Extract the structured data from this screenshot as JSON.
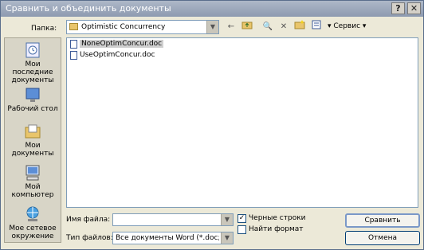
{
  "window": {
    "title": "Сравнить и объединить документы",
    "help_button": "?",
    "close_button": "✕"
  },
  "toolbar": {
    "look_in_label": "Папка:",
    "look_in_value": "Optimistic Concurrency",
    "back_icon": "←",
    "up_icon": "folder-up-icon",
    "search_icon": "🔍",
    "delete_icon": "✕",
    "new_folder_icon": "new-folder-icon",
    "views_icon": "views-icon",
    "tools_label": "Сервис"
  },
  "places": [
    {
      "label": "Мои последние документы",
      "icon": "recent-icon"
    },
    {
      "label": "Рабочий стол",
      "icon": "desktop-icon"
    },
    {
      "label": "Мои документы",
      "icon": "my-documents-icon"
    },
    {
      "label": "Мой компьютер",
      "icon": "computer-icon"
    },
    {
      "label": "Мое сетевое окружение",
      "icon": "network-icon"
    }
  ],
  "files": [
    {
      "name": "NoneOptimConcur.doc",
      "selected": true
    },
    {
      "name": "UseOptimConcur.doc",
      "selected": false
    }
  ],
  "bottom": {
    "filename_label": "Имя файла:",
    "filename_value": "",
    "filetype_label": "Тип файлов:",
    "filetype_value": "Все документы Word (*.doc; *.d",
    "legal_blackline_label": "Черные строки",
    "legal_blackline_checked": true,
    "find_formatting_label": "Найти формат",
    "find_formatting_checked": false,
    "compare_button": "Сравнить",
    "cancel_button": "Отмена"
  }
}
